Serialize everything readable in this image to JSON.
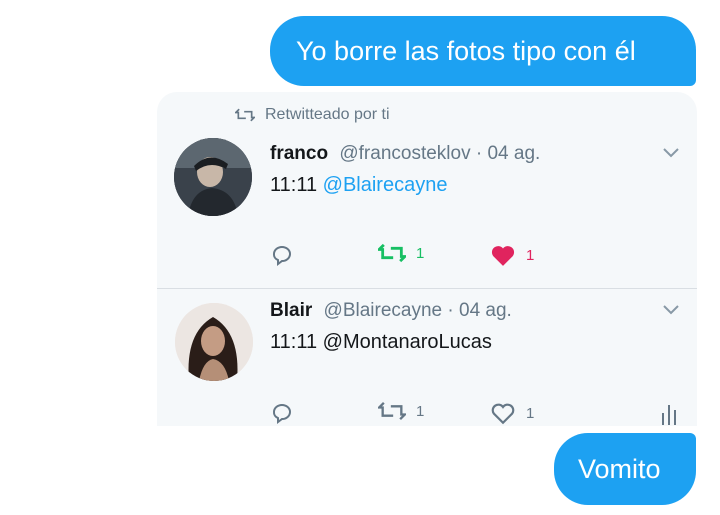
{
  "messages": {
    "top": "Yo borre las fotos tipo con él",
    "bottom": "Vomito"
  },
  "card": {
    "retweet_context": "Retwitteado por ti",
    "tweets": [
      {
        "name": "franco",
        "handle": "@francosteklov",
        "date": "· 04 ag.",
        "text": "11:11",
        "mention": "@Blairecayne",
        "retweets": "1",
        "likes": "1",
        "retweeted": true,
        "liked": true
      },
      {
        "name": "Blair",
        "handle": "@Blairecayne",
        "date": "· 04 ag.",
        "text": "11:11 @MontanaroLucas",
        "retweets": "1",
        "likes": "1",
        "retweeted": false,
        "liked": false
      }
    ]
  },
  "colors": {
    "bubble": "#1da1f2",
    "card_bg": "#f5f8fa",
    "muted": "#657786",
    "retweet_green": "#17bf63",
    "like_red": "#e0245e"
  },
  "icons": [
    "retweet-icon",
    "chevron-down-icon",
    "reply-icon",
    "heart-icon",
    "analytics-icon"
  ]
}
